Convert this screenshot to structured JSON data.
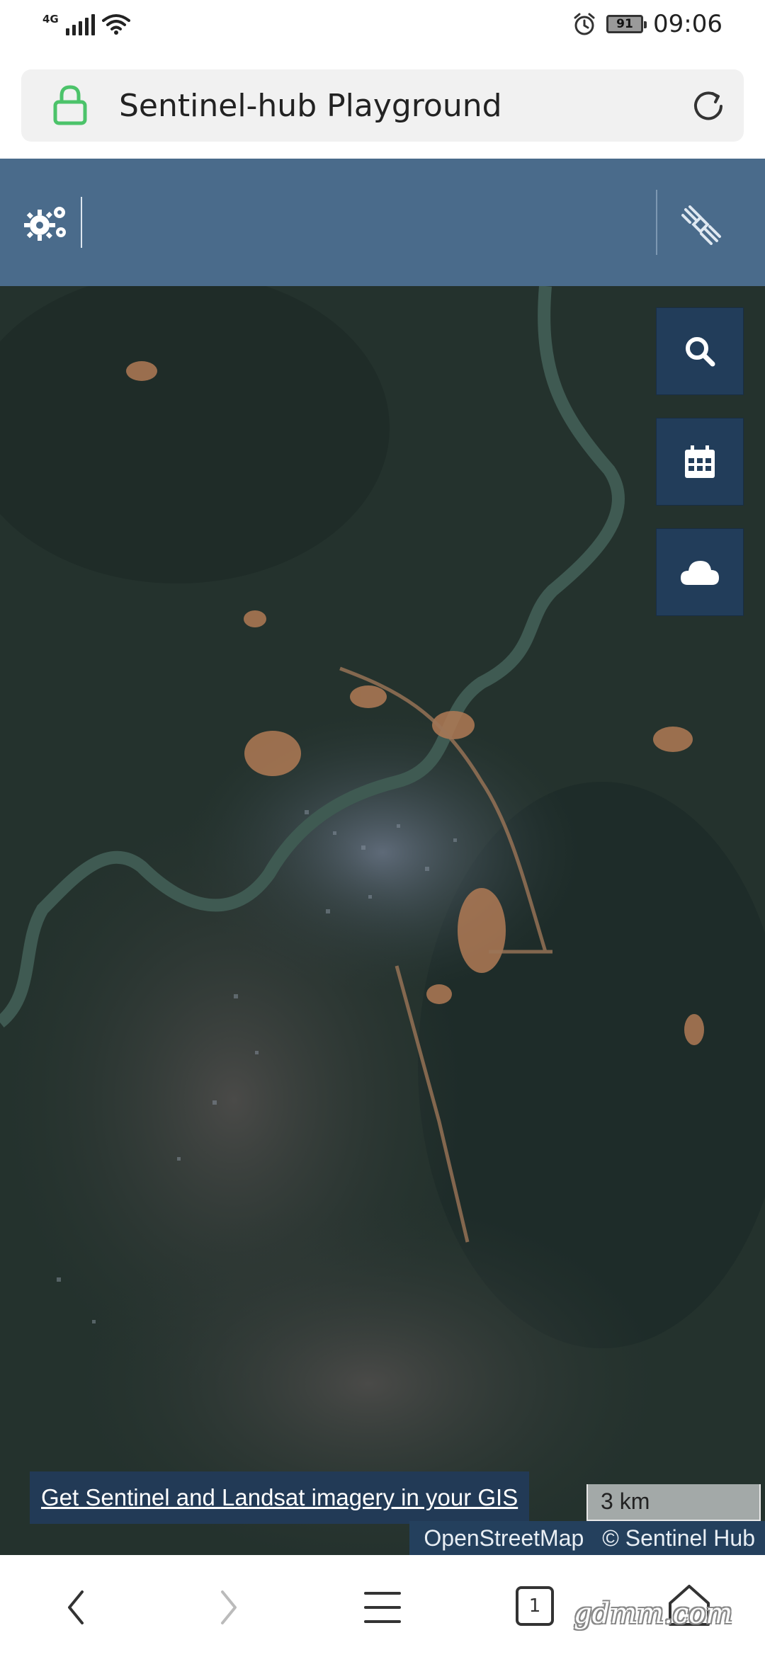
{
  "status_bar": {
    "network_type": "4G",
    "battery": "91",
    "time": "09:06"
  },
  "url_bar": {
    "title": "Sentinel-hub Playground",
    "icons": [
      "lock-icon",
      "reload-icon"
    ]
  },
  "toolbar": {
    "icons": [
      "settings-icon",
      "satellite-icon"
    ]
  },
  "map": {
    "controls": [
      "search-icon",
      "calendar-icon",
      "cloud-icon"
    ],
    "promo_link": "Get Sentinel and Landsat imagery in your GIS",
    "scale": "3 km",
    "attribution_osm": "OpenStreetMap",
    "attribution_sentinel": "© Sentinel Hub"
  },
  "bottom_bar": {
    "tab_count": "1",
    "watermark": "gdmm.com",
    "icons": [
      "back-icon",
      "forward-icon",
      "menu-icon",
      "tabs-icon",
      "home-icon"
    ]
  },
  "colors": {
    "toolbar": "#4a6b8b",
    "map_button": "#223d5a",
    "url_bar_bg": "#f1f1f1",
    "lock_green": "#4cc36a"
  }
}
